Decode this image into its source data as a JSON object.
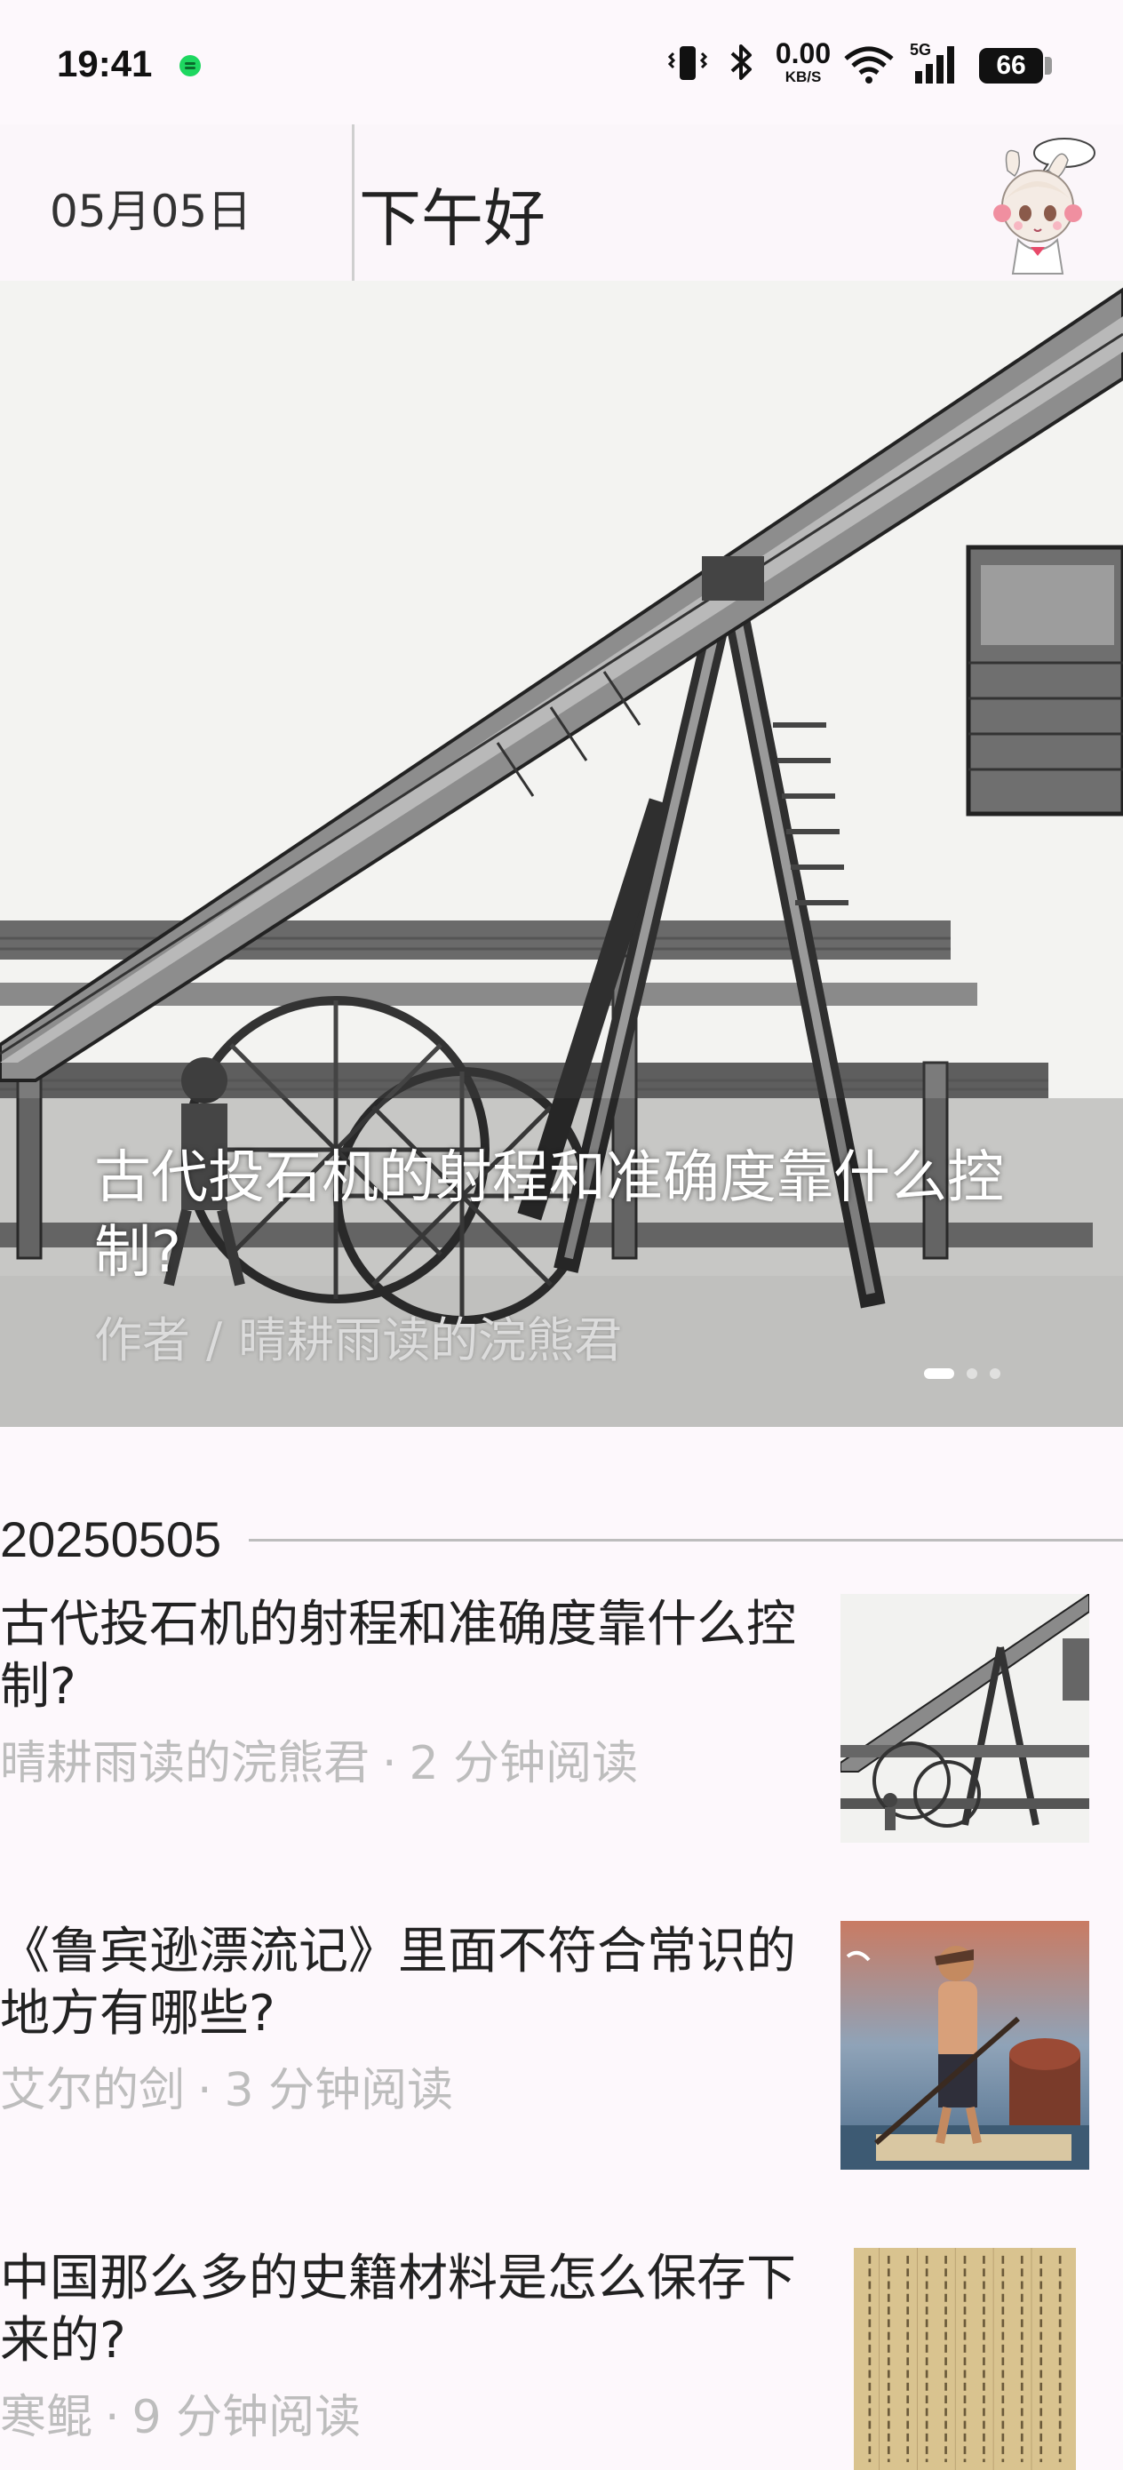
{
  "status_bar": {
    "time": "19:41",
    "net_speed_value": "0.00",
    "net_speed_unit": "KB/S",
    "network_label": "5G",
    "battery": "66",
    "icons": [
      "notification-dot-icon",
      "vibrate-icon",
      "bluetooth-icon",
      "wifi-icon",
      "signal-icon",
      "battery-icon"
    ]
  },
  "header": {
    "date": "05月05日",
    "greeting": "下午好"
  },
  "hero": {
    "title": "古代投石机的射程和准确度靠什么控制?",
    "author_prefix": "作者",
    "author": "晴耕雨读的浣熊君",
    "page_count": 3,
    "active_page": 1
  },
  "section": {
    "date": "20250505"
  },
  "articles": [
    {
      "title": "古代投石机的射程和准确度靠什么控制?",
      "author": "晴耕雨读的浣熊君",
      "read_time": "2 分钟阅读",
      "thumb": "catapult-engraving"
    },
    {
      "title": "《鲁宾逊漂流记》里面不符合常识的地方有哪些?",
      "author": "艾尔的剑",
      "read_time": "3 分钟阅读",
      "thumb": "castaway-painting"
    },
    {
      "title": "中国那么多的史籍材料是怎么保存下来的?",
      "author": "寒鲲",
      "read_time": "9 分钟阅读",
      "thumb": "ancient-manuscript"
    }
  ],
  "colors": {
    "background": "#fdf8fc",
    "meta_text": "#bdbdbd",
    "status_green": "#1ed760"
  }
}
